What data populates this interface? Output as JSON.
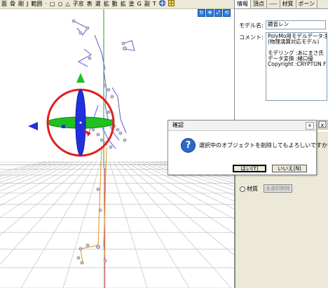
{
  "toolbar": {
    "items": [
      "面",
      "骨",
      "剛",
      "J",
      "範囲",
      "·",
      "□",
      "○",
      "△",
      "子窓",
      "表",
      "選",
      "拡",
      "動",
      "拡",
      "塗",
      "G",
      "副",
      "T"
    ]
  },
  "right_panel": {
    "tabs": [
      "情報",
      "頂点",
      "----",
      "材質",
      "ボーン"
    ],
    "model_name_label": "モデル名:",
    "model_name_value": "鏡音レン",
    "comment_label": "コメント:",
    "comment_lines": [
      "PolyMo用モデルデータ:鏡音レン",
      "(物理演算対応モデル)",
      "",
      "モデリング :あにまさ氏",
      "データ変換 :緒口優",
      "Copyright :CRYPTON FUTU"
    ],
    "radio_material": "材質",
    "delete_label": "全選択削除"
  },
  "dialog": {
    "title": "確認",
    "message": "選択中のオブジェクトを削除してもよろしいですか?",
    "yes": "はい(Y)",
    "no": "いいえ(N)",
    "close": "x"
  },
  "colors": {
    "gizmo_red": "#e02020",
    "gizmo_green": "#20c020",
    "gizmo_blue": "#2030e0",
    "axis_green": "#2a9d2a",
    "axis_red": "#c03030"
  }
}
